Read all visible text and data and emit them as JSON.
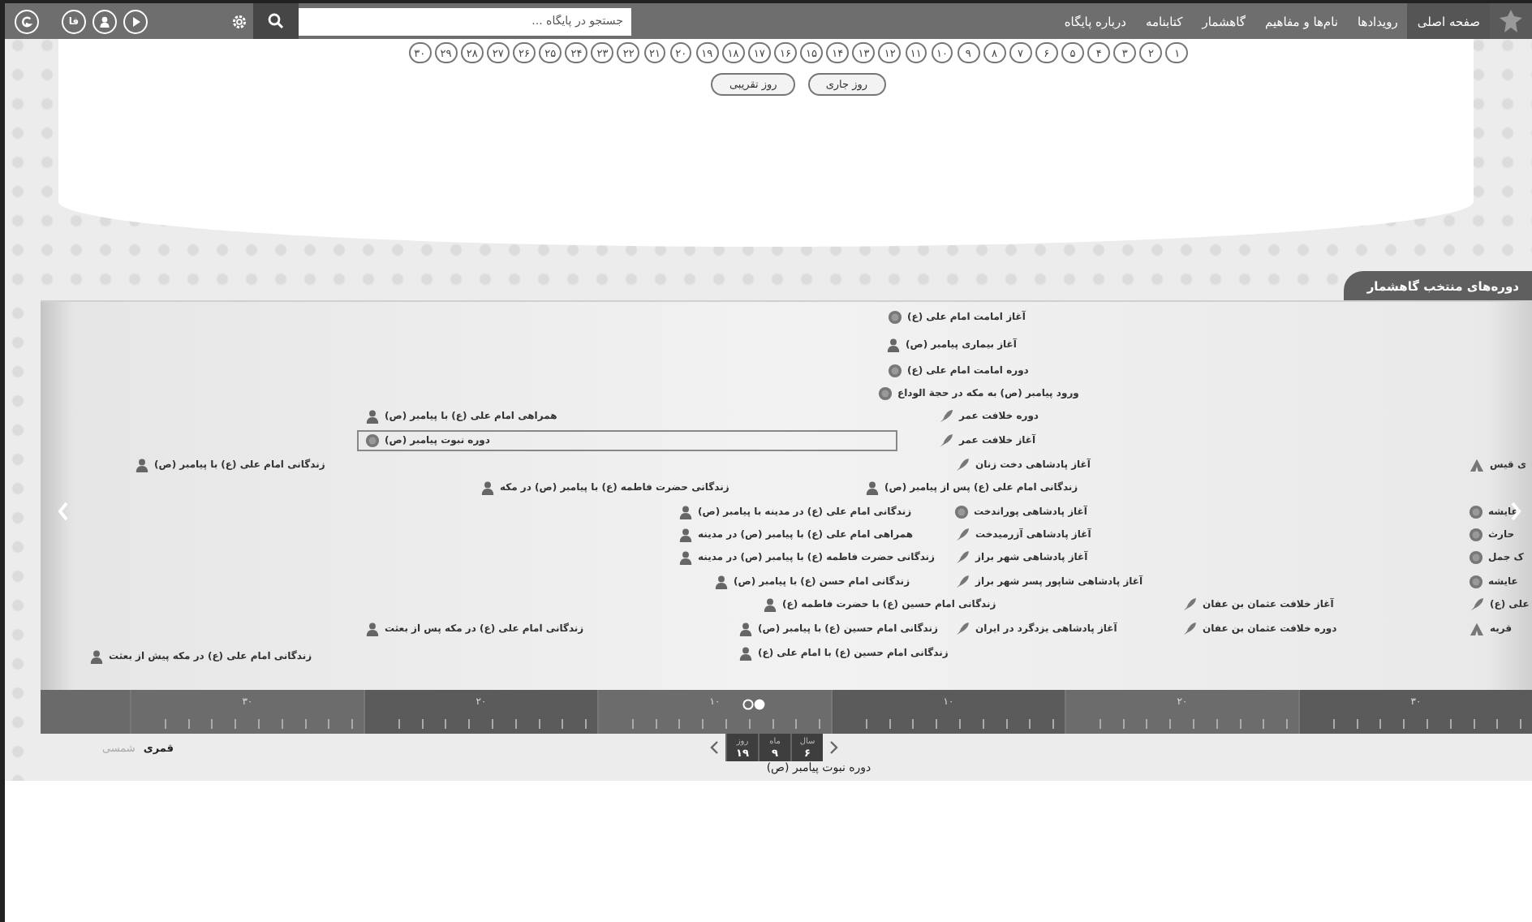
{
  "nav": {
    "menu": [
      {
        "label": "صفحه اصلی",
        "selected": true
      },
      {
        "label": "رویدادها",
        "selected": false
      },
      {
        "label": "نام‌ها و مفاهیم",
        "selected": false
      },
      {
        "label": "گاهشمار",
        "selected": false
      },
      {
        "label": "کتابنامه",
        "selected": false
      },
      {
        "label": "درباره پایگاه",
        "selected": false
      }
    ],
    "search": {
      "placeholder": "جستجو در پایگاه ..."
    },
    "language": "فا"
  },
  "days": {
    "numbers": [
      "۱",
      "۲",
      "۳",
      "۴",
      "۵",
      "۶",
      "۷",
      "۸",
      "۹",
      "۱۰",
      "۱۱",
      "۱۲",
      "۱۳",
      "۱۴",
      "۱۵",
      "۱۶",
      "۱۷",
      "۱۸",
      "۱۹",
      "۲۰",
      "۲۱",
      "۲۲",
      "۲۳",
      "۲۴",
      "۲۵",
      "۲۶",
      "۲۷",
      "۲۸",
      "۲۹",
      "۳۰"
    ],
    "buttons": [
      "روز جاری",
      "روز تقریبی"
    ]
  },
  "section": {
    "title": "دوره‌های منتخب گاهشمار"
  },
  "events": [
    {
      "label": "آغاز امامت امام علی (ع)",
      "kind": "seal",
      "selected": false
    },
    {
      "label": "آغاز بیماری پیامبر (ص)",
      "kind": "person",
      "selected": false
    },
    {
      "label": "دوره امامت امام علی (ع)",
      "kind": "seal",
      "selected": false
    },
    {
      "label": "ورود پیامبر (ص) به مکه در حجة الوداع",
      "kind": "seal",
      "selected": false
    },
    {
      "label": "دوره خلافت عمر",
      "kind": "quill",
      "selected": false
    },
    {
      "label": "همراهی امام علی (ع) با پیامبر (ص)",
      "kind": "person",
      "selected": false
    },
    {
      "label": "آغاز خلافت عمر",
      "kind": "quill",
      "selected": false
    },
    {
      "label": "دوره نبوت پیامبر (ص)",
      "kind": "seal",
      "selected": true
    },
    {
      "label": "ی قیس",
      "kind": "tent",
      "selected": false
    },
    {
      "label": "آغاز پادشاهی دخت زنان",
      "kind": "quill",
      "selected": false
    },
    {
      "label": "زندگانی امام علی (ع) با پیامبر (ص)",
      "kind": "person",
      "selected": false
    },
    {
      "label": "زندگانی امام علی (ع) پس از پیامبر (ص)",
      "kind": "person",
      "selected": false
    },
    {
      "label": "زندگانی حضرت فاطمه (ع) با پیامبر (ص) در مکه",
      "kind": "person",
      "selected": false
    },
    {
      "label": "عایشه",
      "kind": "seal",
      "selected": false
    },
    {
      "label": "آغاز پادشاهی پوراندخت",
      "kind": "seal",
      "selected": false
    },
    {
      "label": "زندگانی امام علی (ع) در مدینه با پیامبر (ص)",
      "kind": "person",
      "selected": false
    },
    {
      "label": "حارث",
      "kind": "seal",
      "selected": false
    },
    {
      "label": "آغاز پادشاهی آزرمیدخت",
      "kind": "quill",
      "selected": false
    },
    {
      "label": "همراهی امام علی (ع) با پیامبر (ص) در مدینه",
      "kind": "person",
      "selected": false
    },
    {
      "label": "ک جمل",
      "kind": "seal",
      "selected": false
    },
    {
      "label": "آغاز پادشاهی شهر براز",
      "kind": "quill",
      "selected": false
    },
    {
      "label": "زندگانی حضرت فاطمه (ع) با پیامبر (ص) در مدینه",
      "kind": "person",
      "selected": false
    },
    {
      "label": "عایشه",
      "kind": "seal",
      "selected": false
    },
    {
      "label": "آغاز پادشاهی شاپور پسر شهر براز",
      "kind": "quill",
      "selected": false
    },
    {
      "label": "زندگانی امام حسن (ع) با پیامبر (ص)",
      "kind": "person",
      "selected": false
    },
    {
      "label": "علی (ع)",
      "kind": "quill",
      "selected": false
    },
    {
      "label": "آغاز خلافت عثمان بن عفان",
      "kind": "quill",
      "selected": false
    },
    {
      "label": "زندگانی امام حسین (ع) با حضرت فاطمه (ع)",
      "kind": "person",
      "selected": false
    },
    {
      "label": "قریه",
      "kind": "tent",
      "selected": false
    },
    {
      "label": "دوره خلافت عثمان بن عفان",
      "kind": "quill",
      "selected": false
    },
    {
      "label": "آغاز پادشاهی یزدگرد در ایران",
      "kind": "quill",
      "selected": false
    },
    {
      "label": "زندگانی امام حسین (ع) با پیامبر (ص)",
      "kind": "person",
      "selected": false
    },
    {
      "label": "زندگانی امام علی (ع) در مکه پس از بعثت",
      "kind": "person",
      "selected": false
    },
    {
      "label": "زندگانی امام حسین (ع) با امام علی (ع)",
      "kind": "person",
      "selected": false
    },
    {
      "label": "زندگانی امام علی (ع) در مکه پیش از بعثت",
      "kind": "person",
      "selected": false
    }
  ],
  "scale": {
    "labels": [
      "۳۰",
      "۲۰",
      "۱۰",
      "۱۰",
      "۲۰",
      "۳۰"
    ]
  },
  "calendars": [
    {
      "label": "قمری",
      "selected": true
    },
    {
      "label": "شمسی",
      "selected": false
    }
  ],
  "date": [
    {
      "unit": "سال",
      "value": "۶"
    },
    {
      "unit": "ماه",
      "value": "۹"
    },
    {
      "unit": "روز",
      "value": "۱۹"
    }
  ],
  "caption": "دوره نبوت پیامبر (ص)"
}
